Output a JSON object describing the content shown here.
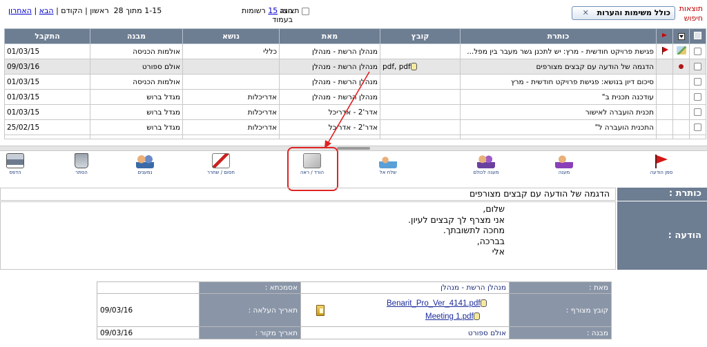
{
  "topbar": {
    "search_results_title": "תוצאות חיפוש",
    "include_notes_button": "כולל משימות והערות",
    "include_notes_close": "✕",
    "show_checkbox_label": "תצוגה",
    "per_page_prefix": "הצג",
    "per_page_count": "15",
    "per_page_suffix": "רשומות בעמוד",
    "paging": {
      "range": "1-15 מתוך 28",
      "first": "ראשון",
      "sep": "|",
      "prev": "הקודם",
      "next": "הבא",
      "last": "האחרון"
    }
  },
  "table": {
    "headers": {
      "subject": "כותרת",
      "file": "קובץ",
      "from": "מאת",
      "topic": "נושא",
      "building": "מבנה",
      "received": "התקבל"
    },
    "rows": [
      {
        "flag": true,
        "dot": false,
        "edit": true,
        "subject": "פגישת פרויקט חודשית - מרץ: יש לתכנן גשר מעבר בין מפל...",
        "file": "",
        "from": "מנהלן הרשת - מנהלן",
        "topic": "כללי",
        "building": "אולמות הכניסה",
        "received": "01/03/15",
        "selected": false
      },
      {
        "flag": false,
        "dot": true,
        "edit": false,
        "subject": "הדגמה של הודעה עם קבצים מצורפים",
        "file": "pdf, pdf",
        "from": "מנהלן הרשת - מנהלן",
        "topic": "",
        "building": "אולם ספורט",
        "received": "09/03/16",
        "selected": true
      },
      {
        "flag": false,
        "dot": false,
        "edit": false,
        "subject": "סיכום דיון בנושא: פגישת פרויקט חודשית - מרץ",
        "file": "",
        "from": "מנהלן הרשת - מנהלן",
        "topic": "",
        "building": "אולמות הכניסה",
        "received": "01/03/15",
        "selected": false
      },
      {
        "flag": false,
        "dot": false,
        "edit": false,
        "subject": "עודכנה תכנית ב\"",
        "file": "",
        "from": "מנהלן הרשת - מנהלן",
        "topic": "אדריכלות",
        "building": "מגדל ברוש",
        "received": "01/03/15",
        "selected": false
      },
      {
        "flag": false,
        "dot": false,
        "edit": false,
        "subject": "תכנית הועברה לאישור",
        "file": "",
        "from": "אדר'2 - אדריכל",
        "topic": "אדריכלות",
        "building": "מגדל ברוש",
        "received": "01/03/15",
        "selected": false
      },
      {
        "flag": false,
        "dot": false,
        "edit": false,
        "subject": "התכנית הועברה ל\"",
        "file": "",
        "from": "אדר'2 - אדריכל",
        "topic": "אדריכלות",
        "building": "מגדל ברוש",
        "received": "25/02/15",
        "selected": false
      }
    ]
  },
  "toolbar": {
    "flag_message": "סמן הודעה",
    "reply": "מענה",
    "reply_all": "מענה לכולם",
    "send_to": "שלח אל",
    "download_view": "הורד / ראה",
    "block_release": "חסום / שחרר",
    "recipients": "נמענים",
    "hide": "הסתר",
    "print": "הדפס"
  },
  "preview": {
    "title_label": "כותרת :",
    "title_value": "הדגמה של הודעה עם קבצים מצורפים",
    "body_label": "הודעה :",
    "body_lines": [
      "שלום,",
      "אני מצרף לך קבצים לעיון.",
      "מחכה לתשובתך.",
      "בברכה,",
      "אלי"
    ]
  },
  "details": {
    "from_label": "מאת :",
    "from_value": "מנהלן הרשת - מנהלן",
    "approval_label": "אסמכתא :",
    "approval_value": "",
    "attached_label": "קובץ מצורף :",
    "attachments": [
      "Benarit_Pro_Ver_4141.pdf",
      "Meeting 1.pdf"
    ],
    "upload_date_label": "תאריך העלאה :",
    "upload_date_value": "09/03/16",
    "building_label": "מבנה :",
    "building_value": "אולם ספורט",
    "source_date_label": "תאריך מקור :",
    "source_date_value": "09/03/16"
  },
  "colors": {
    "header_bg": "#6d7d92",
    "highlight": "#e02020",
    "link": "#0000cc"
  }
}
